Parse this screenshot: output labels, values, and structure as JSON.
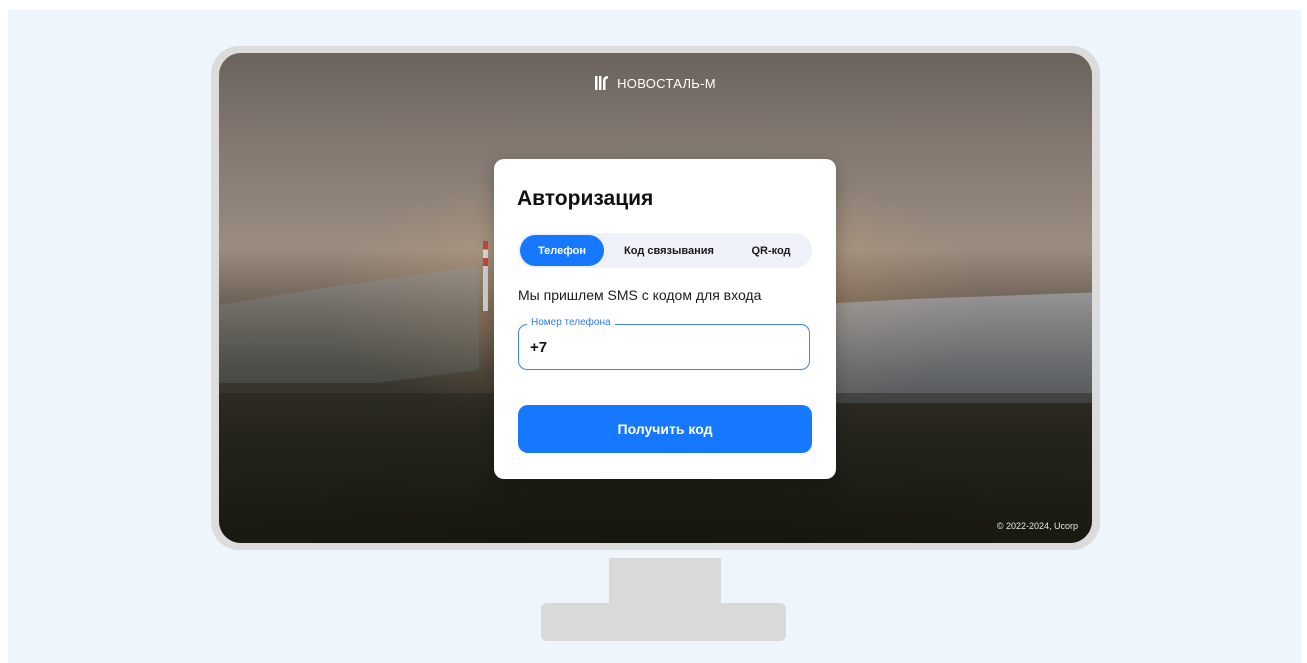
{
  "brand": {
    "name": "НОВОСТАЛЬ-М",
    "icon": "novostal-logo-icon"
  },
  "auth": {
    "title": "Авторизация",
    "tabs": [
      {
        "label": "Телефон",
        "active": true
      },
      {
        "label": "Код связывания",
        "active": false
      },
      {
        "label": "QR-код",
        "active": false
      }
    ],
    "hint": "Мы пришлем SMS с кодом для входа",
    "phone_field": {
      "label": "Номер телефона",
      "value": "+7"
    },
    "submit_label": "Получить код"
  },
  "footer": {
    "copyright": "© 2022-2024, Ucorp"
  },
  "colors": {
    "accent": "#1677ff",
    "page_bg": "#eff5fc",
    "monitor": "#d9d9d9"
  }
}
